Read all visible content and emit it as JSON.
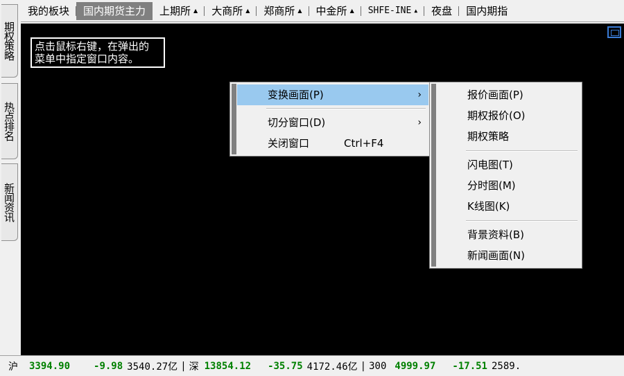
{
  "topbar": {
    "tabs": [
      {
        "label": "我的板块",
        "active": false,
        "arrow": ""
      },
      {
        "label": "国内期货主力",
        "active": true,
        "arrow": ""
      },
      {
        "label": "上期所",
        "active": false,
        "arrow": "▲"
      },
      {
        "label": "大商所",
        "active": false,
        "arrow": "▲"
      },
      {
        "label": "郑商所",
        "active": false,
        "arrow": "▲"
      },
      {
        "label": "中金所",
        "active": false,
        "arrow": "▲"
      },
      {
        "label": "SHFE-INE",
        "active": false,
        "arrow": "▲"
      },
      {
        "label": "夜盘",
        "active": false,
        "arrow": ""
      },
      {
        "label": "国内期指",
        "active": false,
        "arrow": ""
      }
    ]
  },
  "sidebar": {
    "tabs": [
      "期权策略",
      "热点排名",
      "新闻资讯"
    ]
  },
  "main": {
    "hint_line1": "点击鼠标右键，在弹出的",
    "hint_line2": "菜单中指定窗口内容。"
  },
  "context_menu": {
    "items": [
      {
        "label": "变换画面(P)",
        "submenu": "›",
        "shortcut": "",
        "highlighted": true
      },
      {
        "label": "切分窗口(D)",
        "submenu": "›",
        "shortcut": "",
        "highlighted": false
      },
      {
        "label": "关闭窗口",
        "submenu": "",
        "shortcut": "Ctrl+F4",
        "highlighted": false
      }
    ]
  },
  "submenu": {
    "groups": [
      [
        "报价画面(P)",
        "期权报价(O)",
        "期权策略"
      ],
      [
        "闪电图(T)",
        "分时图(M)",
        "K线图(K)"
      ],
      [
        "背景资料(B)",
        "新闻画面(N)"
      ]
    ]
  },
  "status_bar": {
    "sh_label": "沪",
    "sh_index": "3394.90",
    "sh_change": "-9.98",
    "sh_amount": "3540.27亿",
    "sz_label": "深",
    "sz_index": "13854.12",
    "sz_change": "-35.75",
    "sz_amount": "4172.46亿",
    "hs300_label": "300",
    "hs300_index": "4999.97",
    "hs300_change": "-17.51",
    "hs300_amount": "2589."
  },
  "colors": {
    "highlight": "#99c9ef",
    "active_tab": "#808080",
    "positive_green": "#008000",
    "icon_blue": "#3a7bd5"
  }
}
